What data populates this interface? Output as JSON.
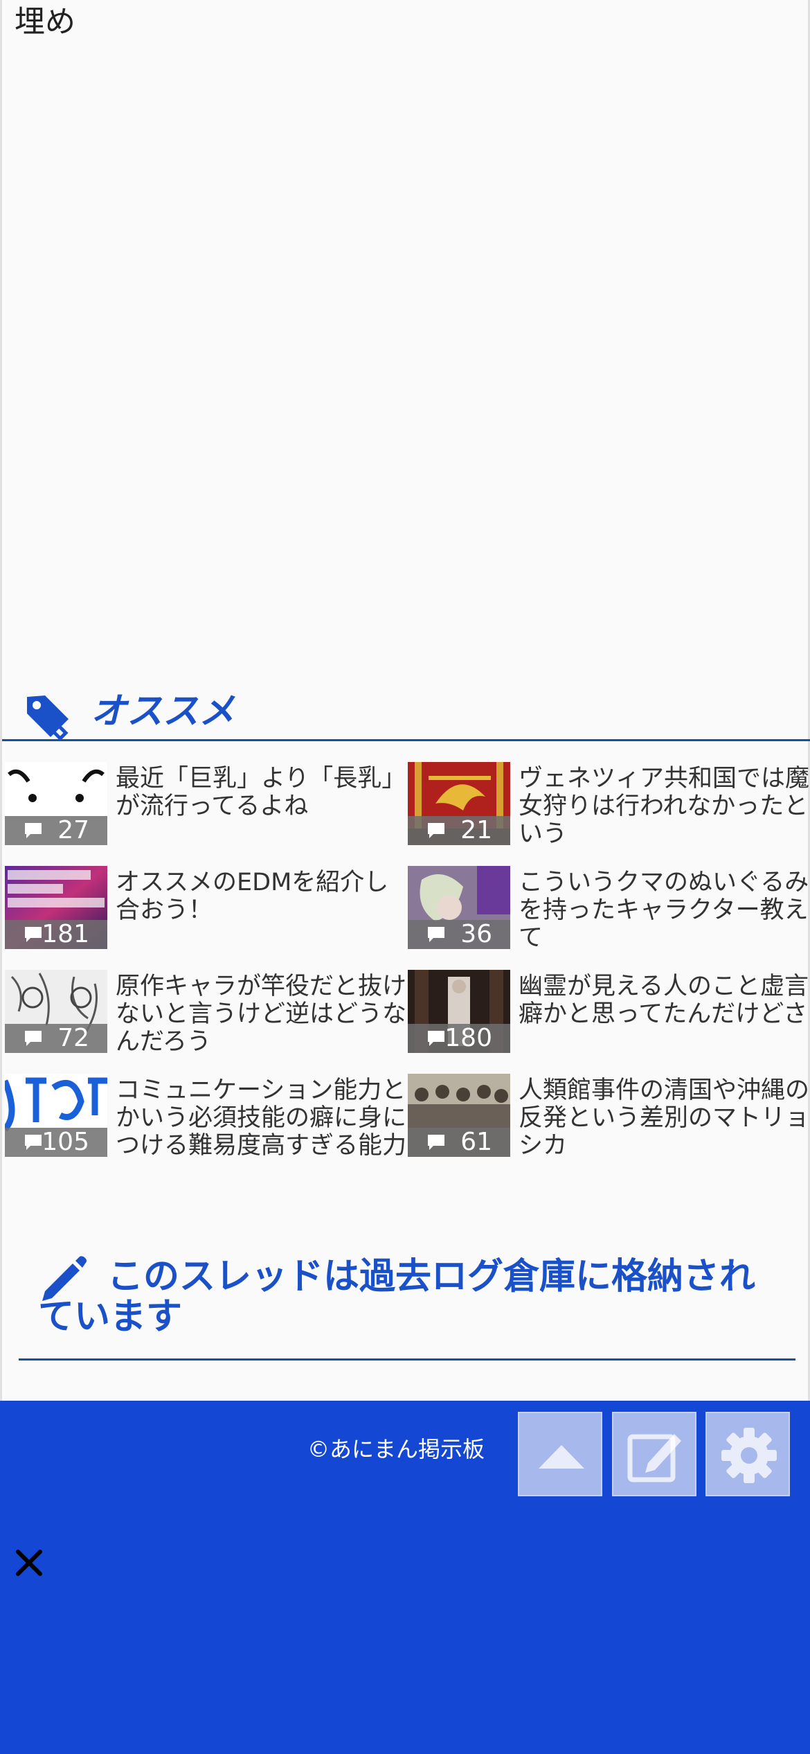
{
  "post": {
    "text": "埋め"
  },
  "recommend": {
    "title": "オススメ",
    "items": [
      {
        "title": "最近「巨乳」より「長乳」が流行ってるよね",
        "count": "27"
      },
      {
        "title": "ヴェネツィア共和国では魔女狩りは行われなかったという",
        "count": "21"
      },
      {
        "title": "オススメのEDMを紹介し合おう！",
        "count": "181"
      },
      {
        "title": "こういうクマのぬいぐるみを持ったキャラクター教えて",
        "count": "36"
      },
      {
        "title": "原作キャラが竿役だと抜けないと言うけど逆はどうなんだろう",
        "count": "72"
      },
      {
        "title": "幽霊が見える人のこと虚言癖かと思ってたんだけどさ",
        "count": "180"
      },
      {
        "title": "コミュニケーション能力とかいう必須技能の癖に身につける難易度高すぎる能力",
        "count": "105"
      },
      {
        "title": "人類館事件の清国や沖縄の反発という差別のマトリョシカ",
        "count": "61"
      }
    ]
  },
  "archive": {
    "notice": "このスレッドは過去ログ倉庫に格納されています"
  },
  "footer": {
    "copyright": "©あにまん掲示板",
    "bg_color": "#1447d4"
  },
  "icons": [
    "tag-icon",
    "comment-icon",
    "pencil-icon",
    "arrow-up-icon",
    "edit-icon",
    "gear-icon",
    "close-icon"
  ],
  "colors": {
    "accent": "#1a50c8",
    "rule": "#1a4f9c"
  }
}
